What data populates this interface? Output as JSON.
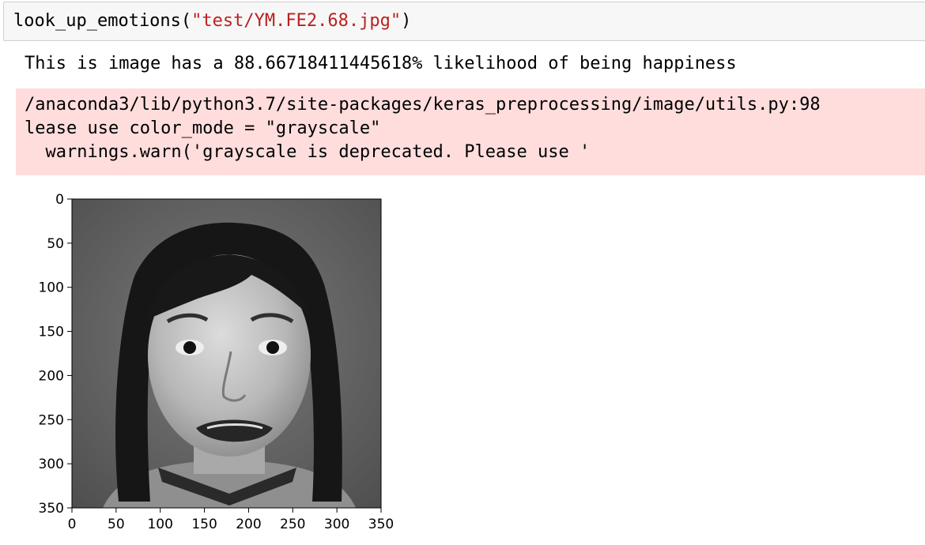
{
  "input_cell": {
    "func": "look_up_emotions(",
    "arg": "\"test/YM.FE2.68.jpg\"",
    "close": ")"
  },
  "output": {
    "stdout": "This is image has a 88.66718411445618% likelihood of being happiness",
    "stderr": [
      "/anaconda3/lib/python3.7/site-packages/keras_preprocessing/image/utils.py:98",
      "lease use color_mode = \"grayscale\"",
      "  warnings.warn('grayscale is deprecated. Please use '"
    ]
  },
  "figure": {
    "image_desc": "grayscale portrait of a woman with a surprised expression",
    "x_ticks": [
      "0",
      "50",
      "100",
      "150",
      "200",
      "250",
      "300",
      "350"
    ],
    "y_ticks": [
      "0",
      "50",
      "100",
      "150",
      "200",
      "250",
      "300",
      "350"
    ],
    "x_range": [
      0,
      350
    ],
    "y_range": [
      0,
      350
    ]
  }
}
